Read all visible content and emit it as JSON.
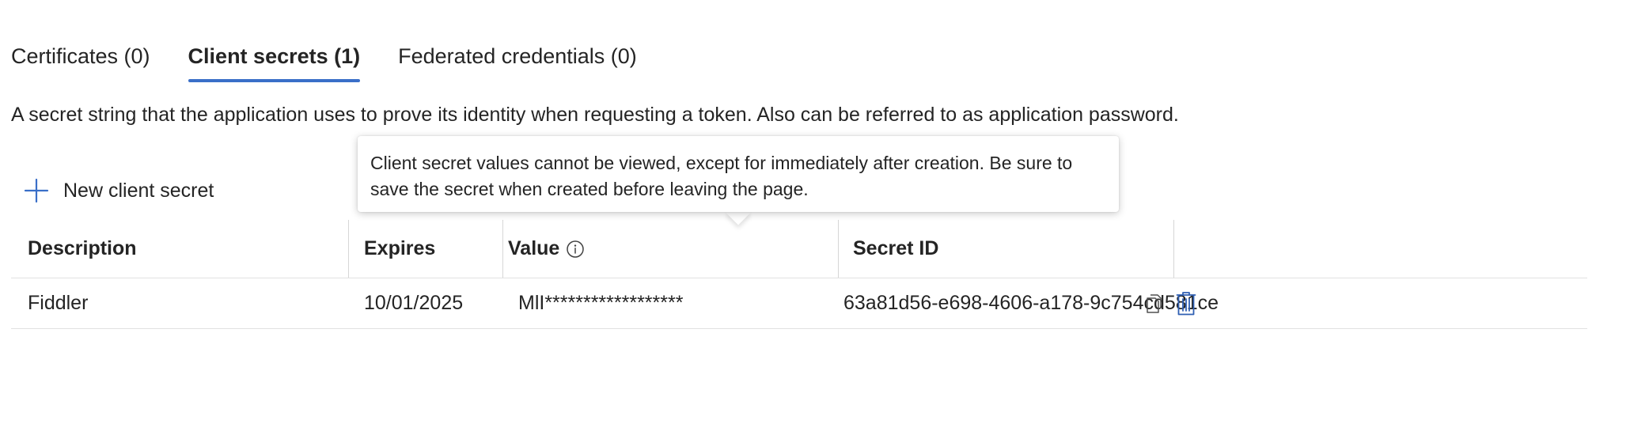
{
  "tabs": [
    {
      "label": "Certificates (0)",
      "active": false
    },
    {
      "label": "Client secrets (1)",
      "active": true
    },
    {
      "label": "Federated credentials (0)",
      "active": false
    }
  ],
  "description": "A secret string that the application uses to prove its identity when requesting a token. Also can be referred to as application password.",
  "new_secret_label": "New client secret",
  "table": {
    "columns": [
      "Description",
      "Expires",
      "Value",
      "Secret ID"
    ],
    "rows": [
      {
        "description": "Fiddler",
        "expires": "10/01/2025",
        "value": "MlI******************",
        "secret_id": "63a81d56-e698-4606-a178-9c754cd581ce"
      }
    ]
  },
  "tooltip": "Client secret values cannot be viewed, except for immediately after creation. Be sure to save the secret when created before leaving the page.",
  "icons": {
    "add": "plus-icon",
    "info": "info-icon",
    "copy": "copy-icon",
    "delete": "trash-icon"
  },
  "colors": {
    "accent": "#3a6fc8",
    "delete": "#2f5fb3"
  }
}
